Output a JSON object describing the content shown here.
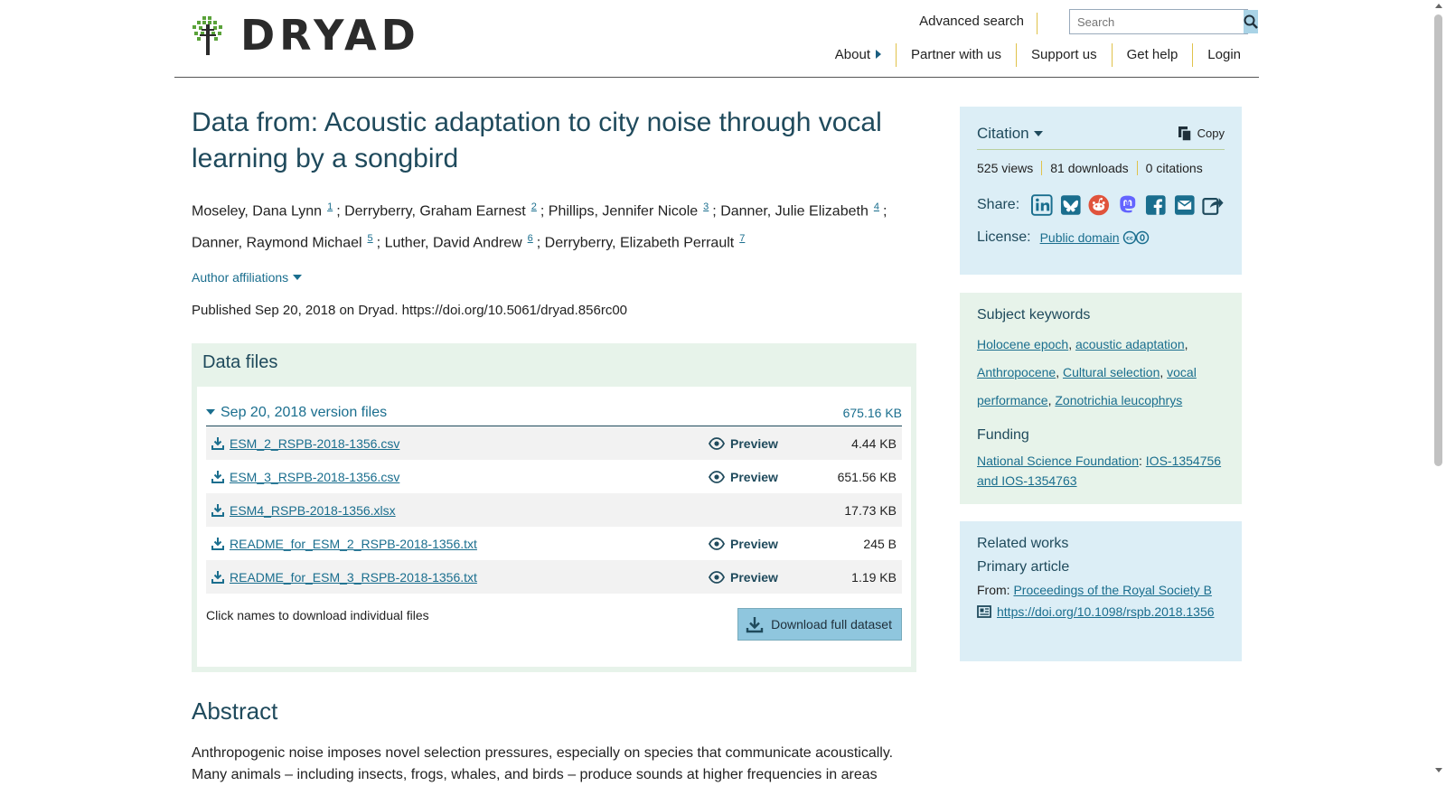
{
  "header": {
    "logo_text": "DRYAD",
    "advanced_search": "Advanced search",
    "search_placeholder": "Search",
    "nav": [
      "About",
      "Partner with us",
      "Support us",
      "Get help",
      "Login"
    ]
  },
  "dataset": {
    "title": "Data from: Acoustic adaptation to city noise through vocal learning by a songbird",
    "authors": [
      {
        "name": "Moseley, Dana Lynn",
        "aff": "1"
      },
      {
        "name": "Derryberry, Graham Earnest",
        "aff": "2"
      },
      {
        "name": "Phillips, Jennifer Nicole",
        "aff": "3"
      },
      {
        "name": "Danner, Julie Elizabeth",
        "aff": "4"
      },
      {
        "name": "Danner, Raymond Michael",
        "aff": "5"
      },
      {
        "name": "Luther, David Andrew",
        "aff": "6"
      },
      {
        "name": "Derryberry, Elizabeth Perrault",
        "aff": "7"
      }
    ],
    "affiliations_toggle": "Author affiliations",
    "published": "Published Sep 20, 2018 on Dryad. https://doi.org/10.5061/dryad.856rc00"
  },
  "data_files": {
    "heading": "Data files",
    "version_label": "Sep 20, 2018 version files",
    "version_size": "675.16 KB",
    "preview_label": "Preview",
    "files": [
      {
        "name": "ESM_2_RSPB-2018-1356.csv",
        "size": "4.44 KB",
        "preview": true
      },
      {
        "name": "ESM_3_RSPB-2018-1356.csv",
        "size": "651.56 KB",
        "preview": true
      },
      {
        "name": "ESM4_RSPB-2018-1356.xlsx",
        "size": "17.73 KB",
        "preview": false
      },
      {
        "name": "README_for_ESM_2_RSPB-2018-1356.txt",
        "size": "245 B",
        "preview": true
      },
      {
        "name": "README_for_ESM_3_RSPB-2018-1356.txt",
        "size": "1.19 KB",
        "preview": true
      }
    ],
    "footer_note": "Click names to download individual files",
    "download_button": "Download full dataset"
  },
  "abstract": {
    "heading": "Abstract",
    "text": "Anthropogenic noise imposes novel selection pressures, especially on species that communicate acoustically. Many animals – including insects, frogs, whales, and birds – produce sounds at higher frequencies in areas"
  },
  "citation": {
    "label": "Citation",
    "copy": "Copy",
    "views": "525 views",
    "downloads": "81 downloads",
    "citations": "0 citations",
    "share_label": "Share:",
    "share_icons": [
      "linkedin-icon",
      "bluesky-icon",
      "reddit-icon",
      "mastodon-icon",
      "facebook-icon",
      "email-icon",
      "share-icon"
    ],
    "license_label": "License:",
    "license_value": "Public domain"
  },
  "subjects": {
    "heading": "Subject keywords",
    "keywords": [
      "Holocene epoch",
      "acoustic adaptation",
      "Anthropocene",
      "Cultural selection",
      "vocal performance",
      "Zonotrichia leucophrys"
    ],
    "funding_heading": "Funding",
    "funder": "National Science Foundation",
    "grant": "IOS-1354756 and IOS-1354763"
  },
  "related": {
    "heading": "Related works",
    "subheading": "Primary article",
    "from_label": "From:",
    "journal": "Proceedings of the Royal Society B",
    "doi": "https://doi.org/10.1098/rspb.2018.1356"
  },
  "colors": {
    "accent": "#1a6e8e",
    "heading": "#1f4a5c",
    "panel_blue": "#dceef6",
    "panel_green": "#e7f3ea",
    "divider_gold": "#e0c24a"
  }
}
